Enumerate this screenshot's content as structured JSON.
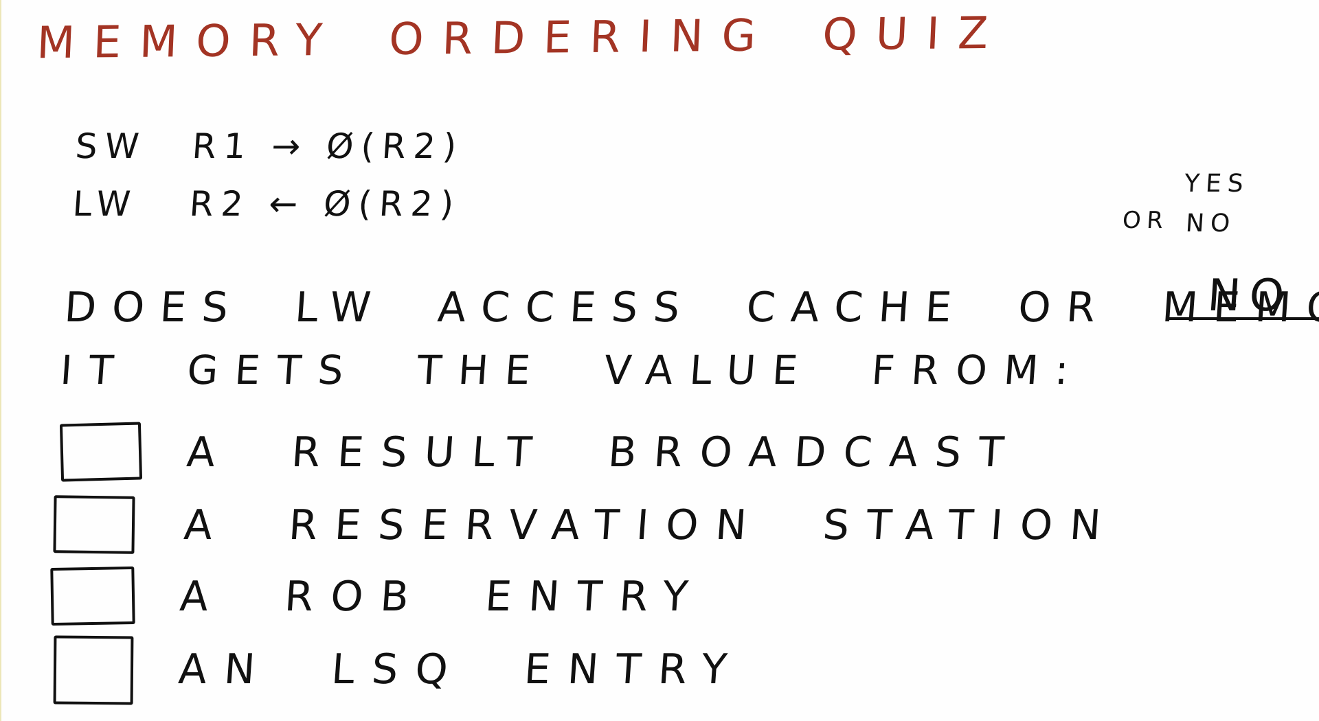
{
  "colors": {
    "title": "#a33424",
    "ink": "#111111",
    "board": "#fefefe"
  },
  "title": {
    "word1": "MEMORY",
    "word2": "ORDERING",
    "word3": "QUIZ"
  },
  "code": {
    "line1": {
      "op": "SW",
      "args": "R1 → Ø(R2)"
    },
    "line2": {
      "op": "LW",
      "args": "R2 ← Ø(R2)"
    }
  },
  "answer_hint": {
    "yes": "YES",
    "or": "OR",
    "no": "NO"
  },
  "question": {
    "text": "DOES LW ACCESS CACHE OR MEMORY?",
    "answer": "NO"
  },
  "prompt": "IT GETS THE VALUE FROM:",
  "options": [
    {
      "label": "A RESULT BROADCAST"
    },
    {
      "label": "A RESERVATION STATION"
    },
    {
      "label": "A ROB ENTRY"
    },
    {
      "label": "AN LSQ ENTRY"
    }
  ]
}
